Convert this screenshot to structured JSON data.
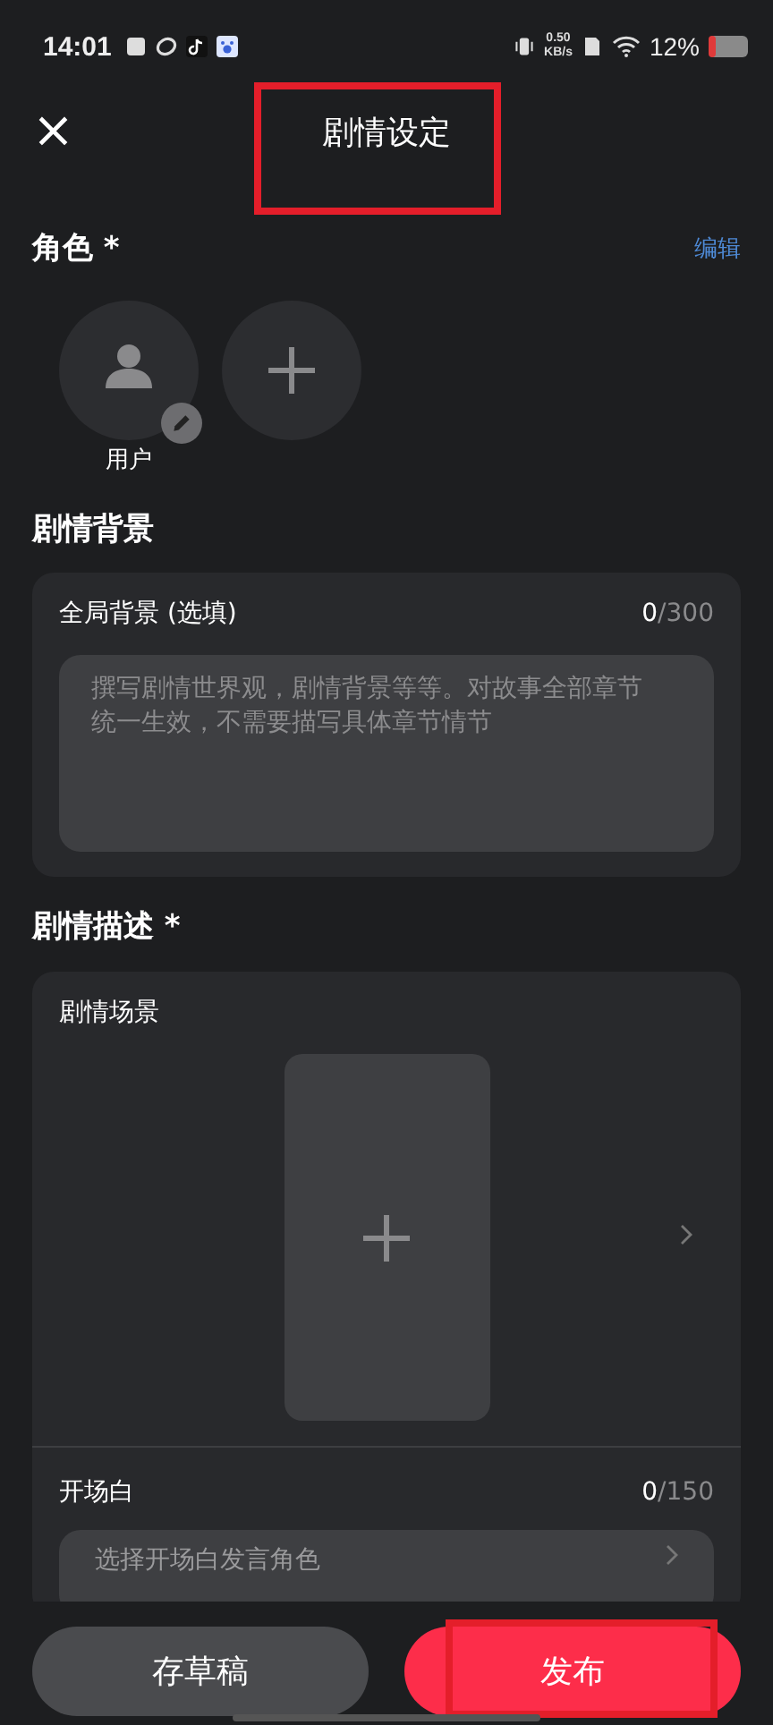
{
  "status_bar": {
    "time": "14:01",
    "net_speed_value": "0.50",
    "net_speed_unit": "KB/s",
    "battery": "12%"
  },
  "header": {
    "title": "剧情设定",
    "close_icon": "×"
  },
  "roles": {
    "title": "角色 *",
    "edit_link": "编辑",
    "items": [
      {
        "kind": "avatar",
        "name": "用户"
      },
      {
        "kind": "add"
      }
    ]
  },
  "background": {
    "title": "剧情背景",
    "card": {
      "label": "全局背景 (选填)",
      "count": "0",
      "limit": "/300",
      "placeholder": "撰写剧情世界观，剧情背景等等。对故事全部章节统一生效，不需要描写具体章节情节"
    }
  },
  "description": {
    "title": "剧情描述 *",
    "scene_label": "剧情场景",
    "opening": {
      "label": "开场白",
      "count": "0",
      "limit": "/150",
      "select_text": "选择开场白发言角色"
    }
  },
  "actions": [
    {
      "label": "存草稿",
      "kind": "secondary"
    },
    {
      "label": "发布",
      "kind": "primary"
    }
  ]
}
